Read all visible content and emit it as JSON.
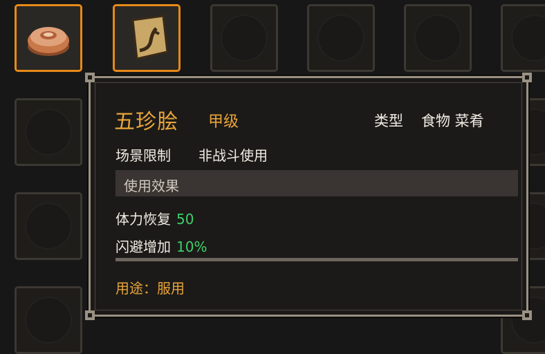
{
  "inventory": {
    "slots": [
      {
        "item": "steamed-bun-icon",
        "selected": true
      },
      {
        "item": "recipe-scroll-icon",
        "selected": true
      },
      {
        "item": null
      },
      {
        "item": null
      },
      {
        "item": null
      },
      {
        "item": null
      }
    ]
  },
  "tooltip": {
    "name": "五珍脍",
    "grade": "甲级",
    "type_label": "类型",
    "type_value": "食物 菜肴",
    "scene_label": "场景限制",
    "scene_value": "非战斗使用",
    "effect_title": "使用效果",
    "effects": [
      {
        "label": "体力恢复",
        "value": "50"
      },
      {
        "label": "闪避增加",
        "value": "10%"
      }
    ],
    "usage": "用途：服用"
  },
  "colors": {
    "accent_orange": "#e88a18",
    "title_gold": "#e8a53a",
    "value_green": "#3ecf6a"
  }
}
